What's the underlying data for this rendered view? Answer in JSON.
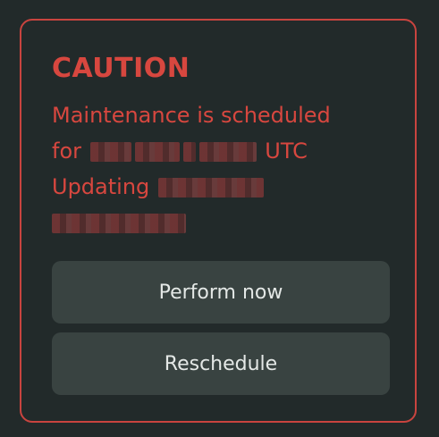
{
  "dialog": {
    "title": "CAUTION",
    "message_line1": "Maintenance is scheduled",
    "message_for": "for",
    "message_utc": "UTC",
    "message_updating": "Updating"
  },
  "buttons": {
    "perform_now": "Perform now",
    "reschedule": "Reschedule"
  },
  "colors": {
    "background": "#222a2a",
    "accent": "#d7473f",
    "button_bg": "#394341",
    "button_text": "#e4e8e6"
  }
}
